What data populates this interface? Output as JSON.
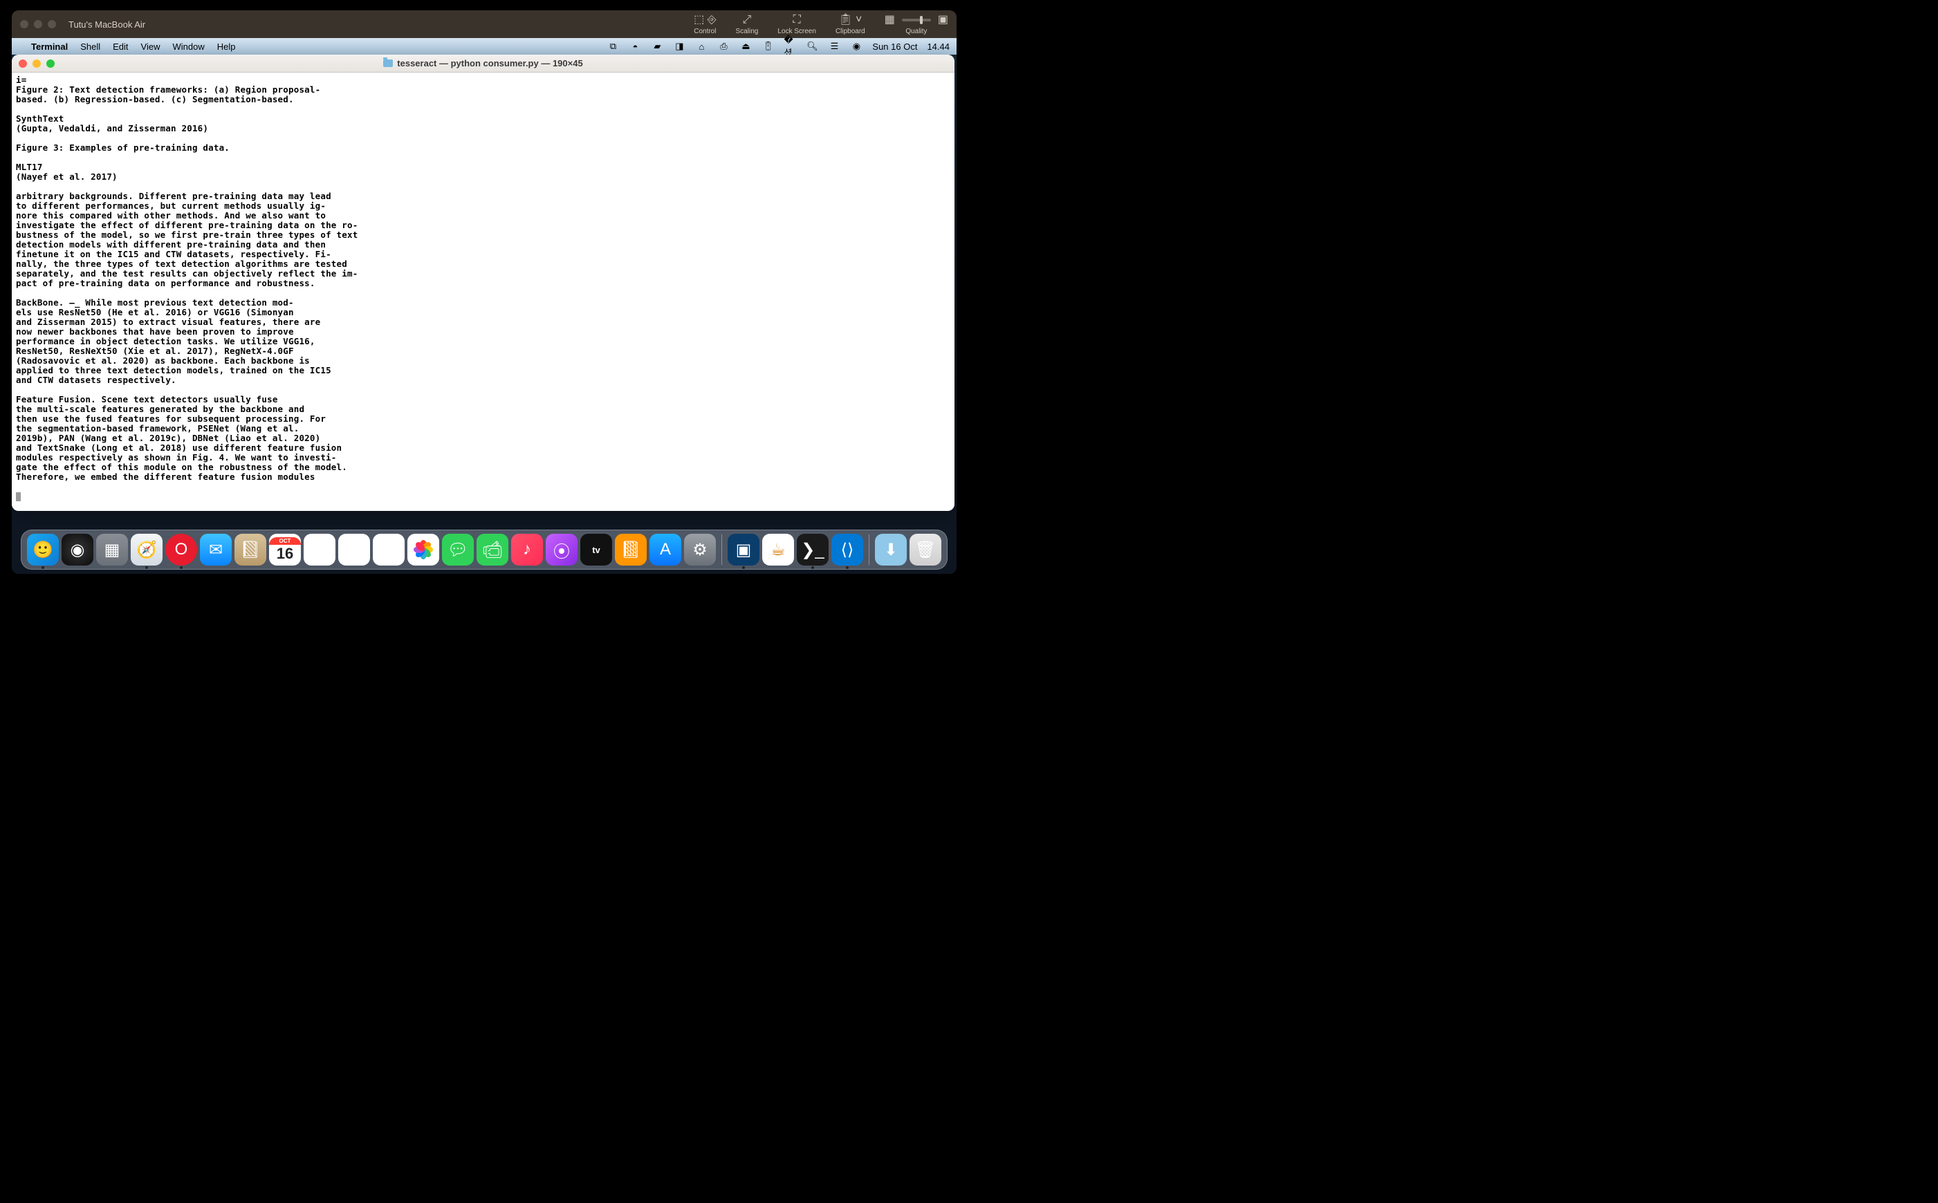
{
  "remote_titlebar": {
    "title": "Tutu's MacBook Air",
    "controls": {
      "control": "Control",
      "scaling": "Scaling",
      "lock_screen": "Lock Screen",
      "clipboard": "Clipboard",
      "quality": "Quality"
    }
  },
  "menubar": {
    "app": "Terminal",
    "items": [
      "Shell",
      "Edit",
      "View",
      "Window",
      "Help"
    ],
    "status_date": "Sun 16 Oct",
    "status_time": "14.44"
  },
  "terminal": {
    "title": "tesseract — python consumer.py — 190×45",
    "lines": [
      "i=",
      "Figure 2: Text detection frameworks: (a) Region proposal-",
      "based. (b) Regression-based. (c) Segmentation-based.",
      "",
      "SynthText",
      "(Gupta, Vedaldi, and Zisserman 2016)",
      "",
      "Figure 3: Examples of pre-training data.",
      "",
      "MLT17",
      "(Nayef et al. 2017)",
      "",
      "arbitrary backgrounds. Different pre-training data may lead",
      "to different performances, but current methods usually ig-",
      "nore this compared with other methods. And we also want to",
      "investigate the effect of different pre-training data on the ro-",
      "bustness of the model, so we first pre-train three types of text",
      "detection models with different pre-training data and then",
      "finetune it on the IC15 and CTW datasets, respectively. Fi-",
      "nally, the three types of text detection algorithms are tested",
      "separately, and the test results can objectively reflect the im-",
      "pact of pre-training data on performance and robustness.",
      "",
      "BackBone. —_ While most previous text detection mod-",
      "els use ResNet50 (He et al. 2016) or VGG16 (Simonyan",
      "and Zisserman 2015) to extract visual features, there are",
      "now newer backbones that have been proven to improve",
      "performance in object detection tasks. We utilize VGG16,",
      "ResNet50, ResNeXt50 (Xie et al. 2017), RegNetX-4.0GF",
      "(Radosavovic et al. 2020) as backbone. Each backbone is",
      "applied to three text detection models, trained on the IC15",
      "and CTW datasets respectively.",
      "",
      "Feature Fusion. Scene text detectors usually fuse",
      "the multi-scale features generated by the backbone and",
      "then use the fused features for subsequent processing. For",
      "the segmentation-based framework, PSENet (Wang et al.",
      "2019b), PAN (Wang et al. 2019c), DBNet (Liao et al. 2020)",
      "and TextSnake (Long et al. 2018) use different feature fusion",
      "modules respectively as shown in Fig. 4. We want to investi-",
      "gate the effect of this module on the robustness of the model.",
      "Therefore, we embed the different feature fusion modules"
    ]
  },
  "dock": {
    "calendar": {
      "month": "OCT",
      "day": "16"
    },
    "tv_label": "tv"
  }
}
